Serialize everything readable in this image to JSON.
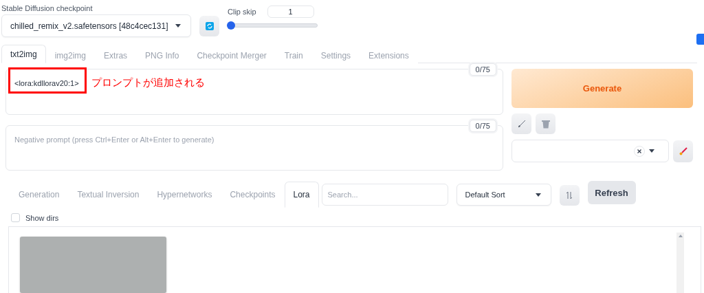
{
  "checkpoint": {
    "label": "Stable Diffusion checkpoint",
    "value": "chilled_remix_v2.safetensors [48c4cec131]"
  },
  "clip_skip": {
    "label": "Clip skip",
    "value": "1",
    "level": 0
  },
  "top_tabs": [
    {
      "label": "txt2img",
      "selected": true
    },
    {
      "label": "img2img",
      "selected": false
    },
    {
      "label": "Extras",
      "selected": false
    },
    {
      "label": "PNG Info",
      "selected": false
    },
    {
      "label": "Checkpoint Merger",
      "selected": false
    },
    {
      "label": "Train",
      "selected": false
    },
    {
      "label": "Settings",
      "selected": false
    },
    {
      "label": "Extensions",
      "selected": false
    }
  ],
  "prompt": {
    "value": "<lora:kdllorav20:1>",
    "counter": "0/75"
  },
  "annotation": {
    "text": "プロンプトが追加される"
  },
  "negative_prompt": {
    "placeholder": "Negative prompt (press Ctrl+Enter or Alt+Enter to generate)",
    "counter": "0/75"
  },
  "generate_button": "Generate",
  "extra_tabs": [
    {
      "label": "Generation",
      "selected": false
    },
    {
      "label": "Textual Inversion",
      "selected": false
    },
    {
      "label": "Hypernetworks",
      "selected": false
    },
    {
      "label": "Checkpoints",
      "selected": false
    },
    {
      "label": "Lora",
      "selected": true
    }
  ],
  "search": {
    "placeholder": "Search..."
  },
  "sort": {
    "value": "Default Sort"
  },
  "refresh_button": "Refresh",
  "show_dirs": {
    "label": "Show dirs",
    "checked": false
  }
}
